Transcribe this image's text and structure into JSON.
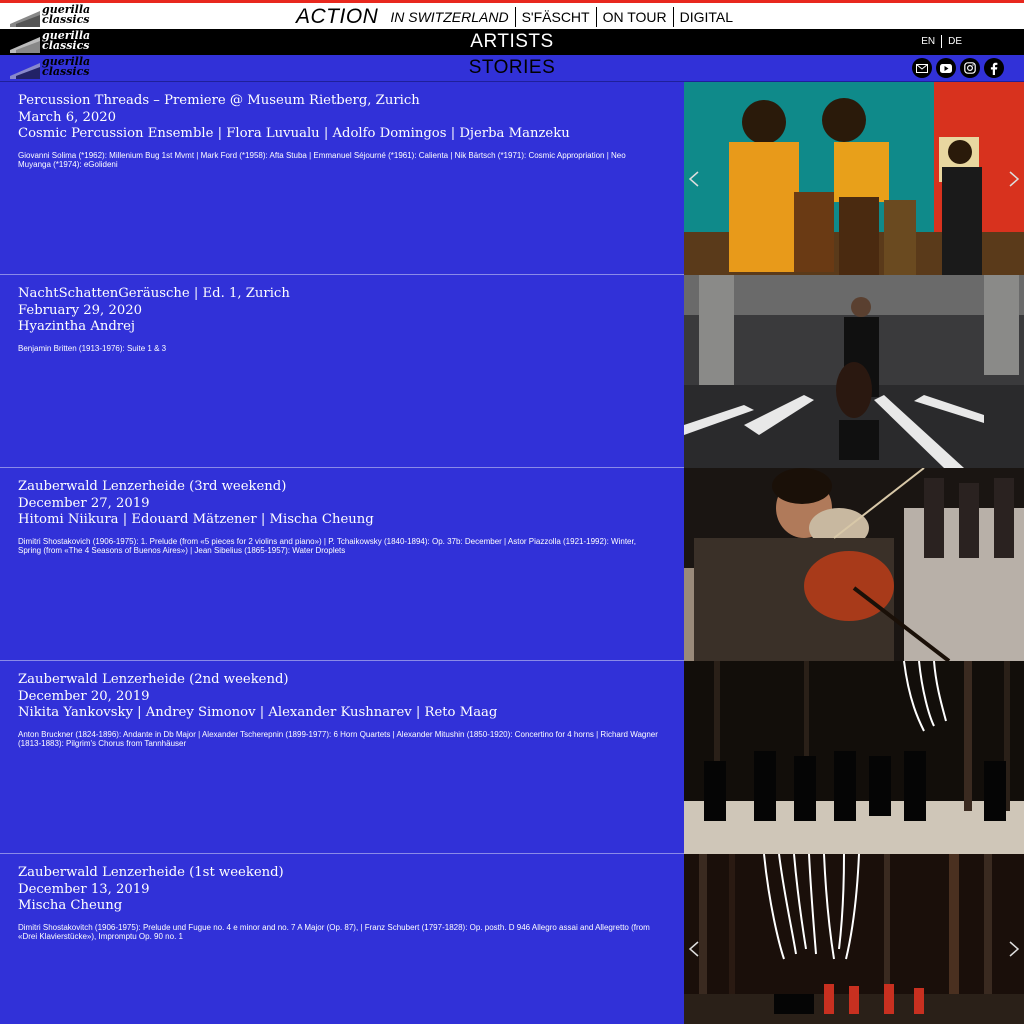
{
  "header": {
    "logo_text": "guerilla classics",
    "nav_action": "ACTION",
    "nav": [
      "IN SWITZERLAND",
      "S'FÄSCHT",
      "ON TOUR",
      "DIGITAL"
    ],
    "artists": "ARTISTS",
    "stories": "STORIES",
    "lang": [
      "EN",
      "DE"
    ],
    "social_icons": [
      "mail-icon",
      "youtube-icon",
      "instagram-icon",
      "facebook-icon"
    ]
  },
  "stories": [
    {
      "title": "Percussion Threads – Premiere @ Museum Rietberg, Zurich",
      "date": "March 6, 2020",
      "artists": "Cosmic Percussion Ensemble | Flora Luvualu | Adolfo Domingos | Djerba Manzeku",
      "program": "Giovanni Solima (*1962): Millenium Bug 1st Mvmt | Mark Ford (*1958): Afta Stuba | Emmanuel Séjourné (*1961): Calienta | Nik Bärtsch (*1971): Cosmic Appropriation | Neo Muyanga (*1974): eGolideni"
    },
    {
      "title": "NachtSchattenGeräusche | Ed. 1, Zurich",
      "date": "February 29, 2020",
      "artists": "Hyazintha Andrej",
      "program": "Benjamin Britten (1913-1976): Suite 1 & 3"
    },
    {
      "title": "Zauberwald Lenzerheide (3rd weekend)",
      "date": "December 27, 2019",
      "artists": "Hitomi Niikura | Edouard Mätzener | Mischa Cheung",
      "program": "Dimitri Shostakovich (1906-1975): 1. Prelude (from «5 pieces for 2 violins and piano») | P. Tchaikowsky (1840-1894): Op. 37b: December | Astor Piazzolla (1921-1992): Winter, Spring (from «The 4 Seasons of Buenos Aires») | Jean Sibelius (1865-1957): Water Droplets"
    },
    {
      "title": "Zauberwald Lenzerheide (2nd weekend)",
      "date": "December 20, 2019",
      "artists": "Nikita Yankovsky | Andrey Simonov | Alexander Kushnarev | Reto Maag",
      "program": "Anton Bruckner (1824-1896): Andante in Db Major | Alexander Tscherepnin (1899-1977): 6 Horn Quartets | Alexander Mitushin (1850-1920): Concertino for 4 horns | Richard Wagner (1813-1883): Pilgrim's Chorus from Tannhäuser"
    },
    {
      "title": "Zauberwald Lenzerheide (1st weekend)",
      "date": "December 13, 2019",
      "artists": "Mischa Cheung",
      "program": "Dimitri Shostakovitch (1906-1975): Prelude und Fugue no. 4 e minor and no. 7 A Major (Op. 87),  | Franz Schubert (1797-1828): Op. posth. D 946 Allegro assai and Allegretto (from «Drei Klavierstücke»), Impromptu Op. 90 no. 1"
    }
  ],
  "colors": {
    "background": "#3131d8",
    "accent": "#e8281e",
    "header_white": "#ffffff",
    "header_black": "#000000"
  }
}
